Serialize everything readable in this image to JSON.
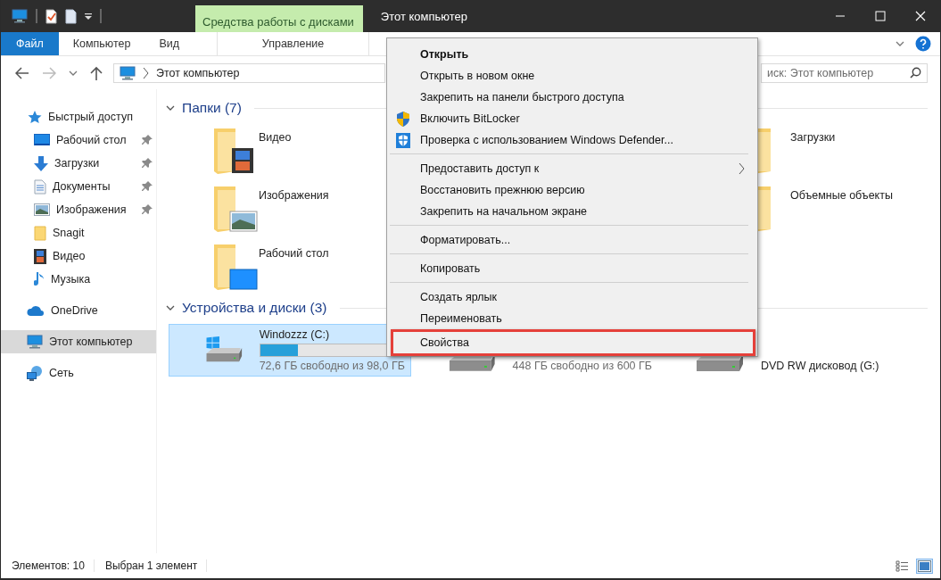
{
  "window": {
    "title": "Этот компьютер"
  },
  "context_tab": {
    "label": "Средства работы с дисками"
  },
  "ribbon_tabs": [
    {
      "label": "Файл",
      "selected": true
    },
    {
      "label": "Компьютер",
      "selected": false
    },
    {
      "label": "Вид",
      "selected": false
    },
    {
      "label": "Управление",
      "selected": false
    }
  ],
  "address_bar": {
    "path": "Этот компьютер"
  },
  "search": {
    "placeholder": "иск: Этот компьютер"
  },
  "sidebar": {
    "items": [
      {
        "label": "Быстрый доступ",
        "selected": false,
        "children": [
          {
            "label": "Рабочий стол",
            "pinned": true,
            "selected": false
          },
          {
            "label": "Загрузки",
            "pinned": true,
            "selected": false
          },
          {
            "label": "Документы",
            "pinned": true,
            "selected": false
          },
          {
            "label": "Изображения",
            "pinned": true,
            "selected": false
          },
          {
            "label": "Snagit",
            "pinned": false,
            "selected": false
          },
          {
            "label": "Видео",
            "pinned": false,
            "selected": false
          },
          {
            "label": "Музыка",
            "pinned": false,
            "selected": false
          }
        ]
      },
      {
        "label": "OneDrive",
        "selected": false
      },
      {
        "label": "Этот компьютер",
        "selected": true
      },
      {
        "label": "Сеть",
        "selected": false
      }
    ]
  },
  "folders": {
    "title": "Папки (7)",
    "expanded": true,
    "items": [
      {
        "name": "Видео"
      },
      {
        "name": "Загрузки"
      },
      {
        "name": "Изображения"
      },
      {
        "name": "Объемные объекты"
      },
      {
        "name": "Рабочий стол"
      }
    ]
  },
  "drives": {
    "title": "Устройства и диски (3)",
    "expanded": true,
    "items": [
      {
        "name": "Windozzz (C:)",
        "level": 0.26,
        "free": "72,6 ГБ свободно из 98,0 ГБ",
        "selected": true
      },
      {
        "free": "448 ГБ свободно из 600 ГБ",
        "selected": false
      },
      {
        "name": "DVD RW дисковод (G:)",
        "selected": false
      }
    ]
  },
  "context_menu": {
    "items": [
      {
        "kind": "item",
        "label": "Открыть",
        "default": true
      },
      {
        "kind": "item",
        "label": "Открыть в новом окне"
      },
      {
        "kind": "item",
        "label": "Закрепить на панели быстрого доступа"
      },
      {
        "kind": "item",
        "label": "Включить BitLocker"
      },
      {
        "kind": "item",
        "label": "Проверка с использованием Windows Defender..."
      },
      {
        "kind": "separator"
      },
      {
        "kind": "item",
        "label": "Предоставить доступ к",
        "submenu": true
      },
      {
        "kind": "item",
        "label": "Восстановить прежнюю версию"
      },
      {
        "kind": "item",
        "label": "Закрепить на начальном экране"
      },
      {
        "kind": "separator"
      },
      {
        "kind": "item",
        "label": "Форматировать..."
      },
      {
        "kind": "separator"
      },
      {
        "kind": "item",
        "label": "Копировать"
      },
      {
        "kind": "separator"
      },
      {
        "kind": "item",
        "label": "Создать ярлык"
      },
      {
        "kind": "item",
        "label": "Переименовать"
      },
      {
        "kind": "item",
        "label": "Свойства",
        "highlighted": true
      }
    ]
  },
  "status_bar": {
    "count": "Элементов: 10",
    "selection": "Выбран 1 элемент",
    "views": [
      {
        "selected": false
      },
      {
        "selected": true
      }
    ]
  }
}
